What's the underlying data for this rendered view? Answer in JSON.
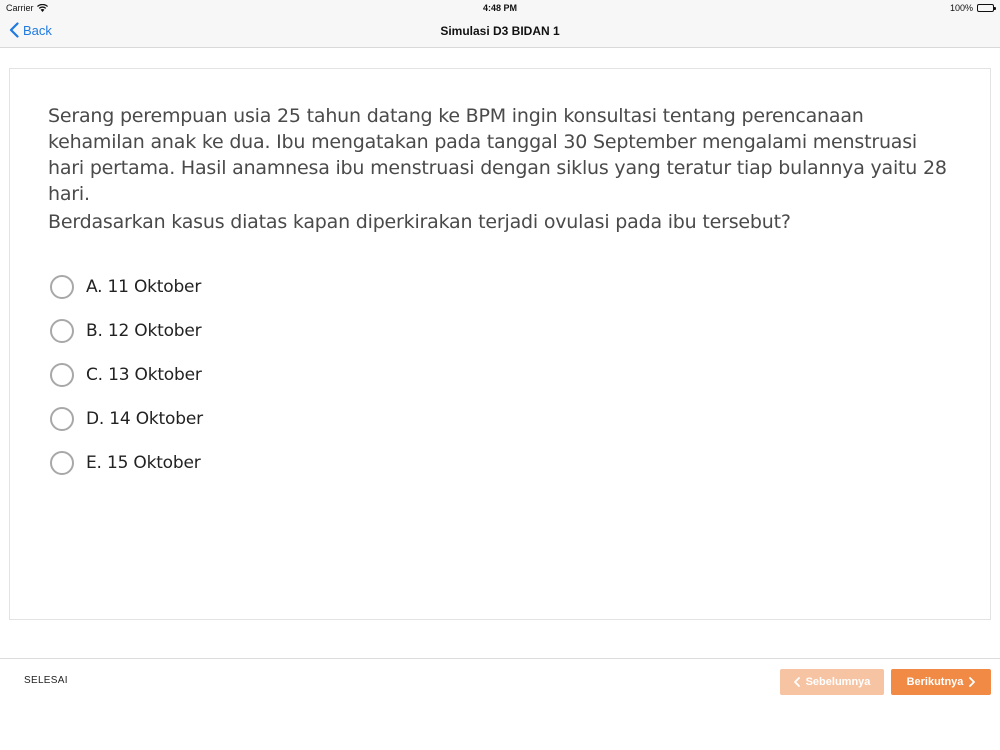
{
  "status_bar": {
    "carrier": "Carrier",
    "time": "4:48 PM",
    "battery": "100%"
  },
  "nav": {
    "back_label": "Back",
    "title": "Simulasi D3 BIDAN 1"
  },
  "question": {
    "text": "Serang perempuan usia 25 tahun datang ke BPM ingin konsultasi tentang perencanaan kehamilan anak ke dua. Ibu mengatakan pada tanggal 30 September mengalami menstruasi hari pertama. Hasil anamnesa ibu menstruasi dengan siklus yang teratur tiap bulannya yaitu 28 hari.",
    "prompt": "Berdasarkan kasus diatas kapan diperkirakan terjadi ovulasi pada ibu tersebut?",
    "options": [
      {
        "label": "A. 11 Oktober"
      },
      {
        "label": "B. 12 Oktober"
      },
      {
        "label": "C. 13 Oktober"
      },
      {
        "label": "D. 14 Oktober"
      },
      {
        "label": "E. 15 Oktober"
      }
    ]
  },
  "footer": {
    "finish_label": "SELESAI",
    "prev_label": "Sebelumnya",
    "next_label": "Berikutnya"
  },
  "colors": {
    "accent_blue": "#1f7ae0",
    "next_orange": "#f08a45",
    "prev_orange_disabled": "#f6c4a3"
  }
}
